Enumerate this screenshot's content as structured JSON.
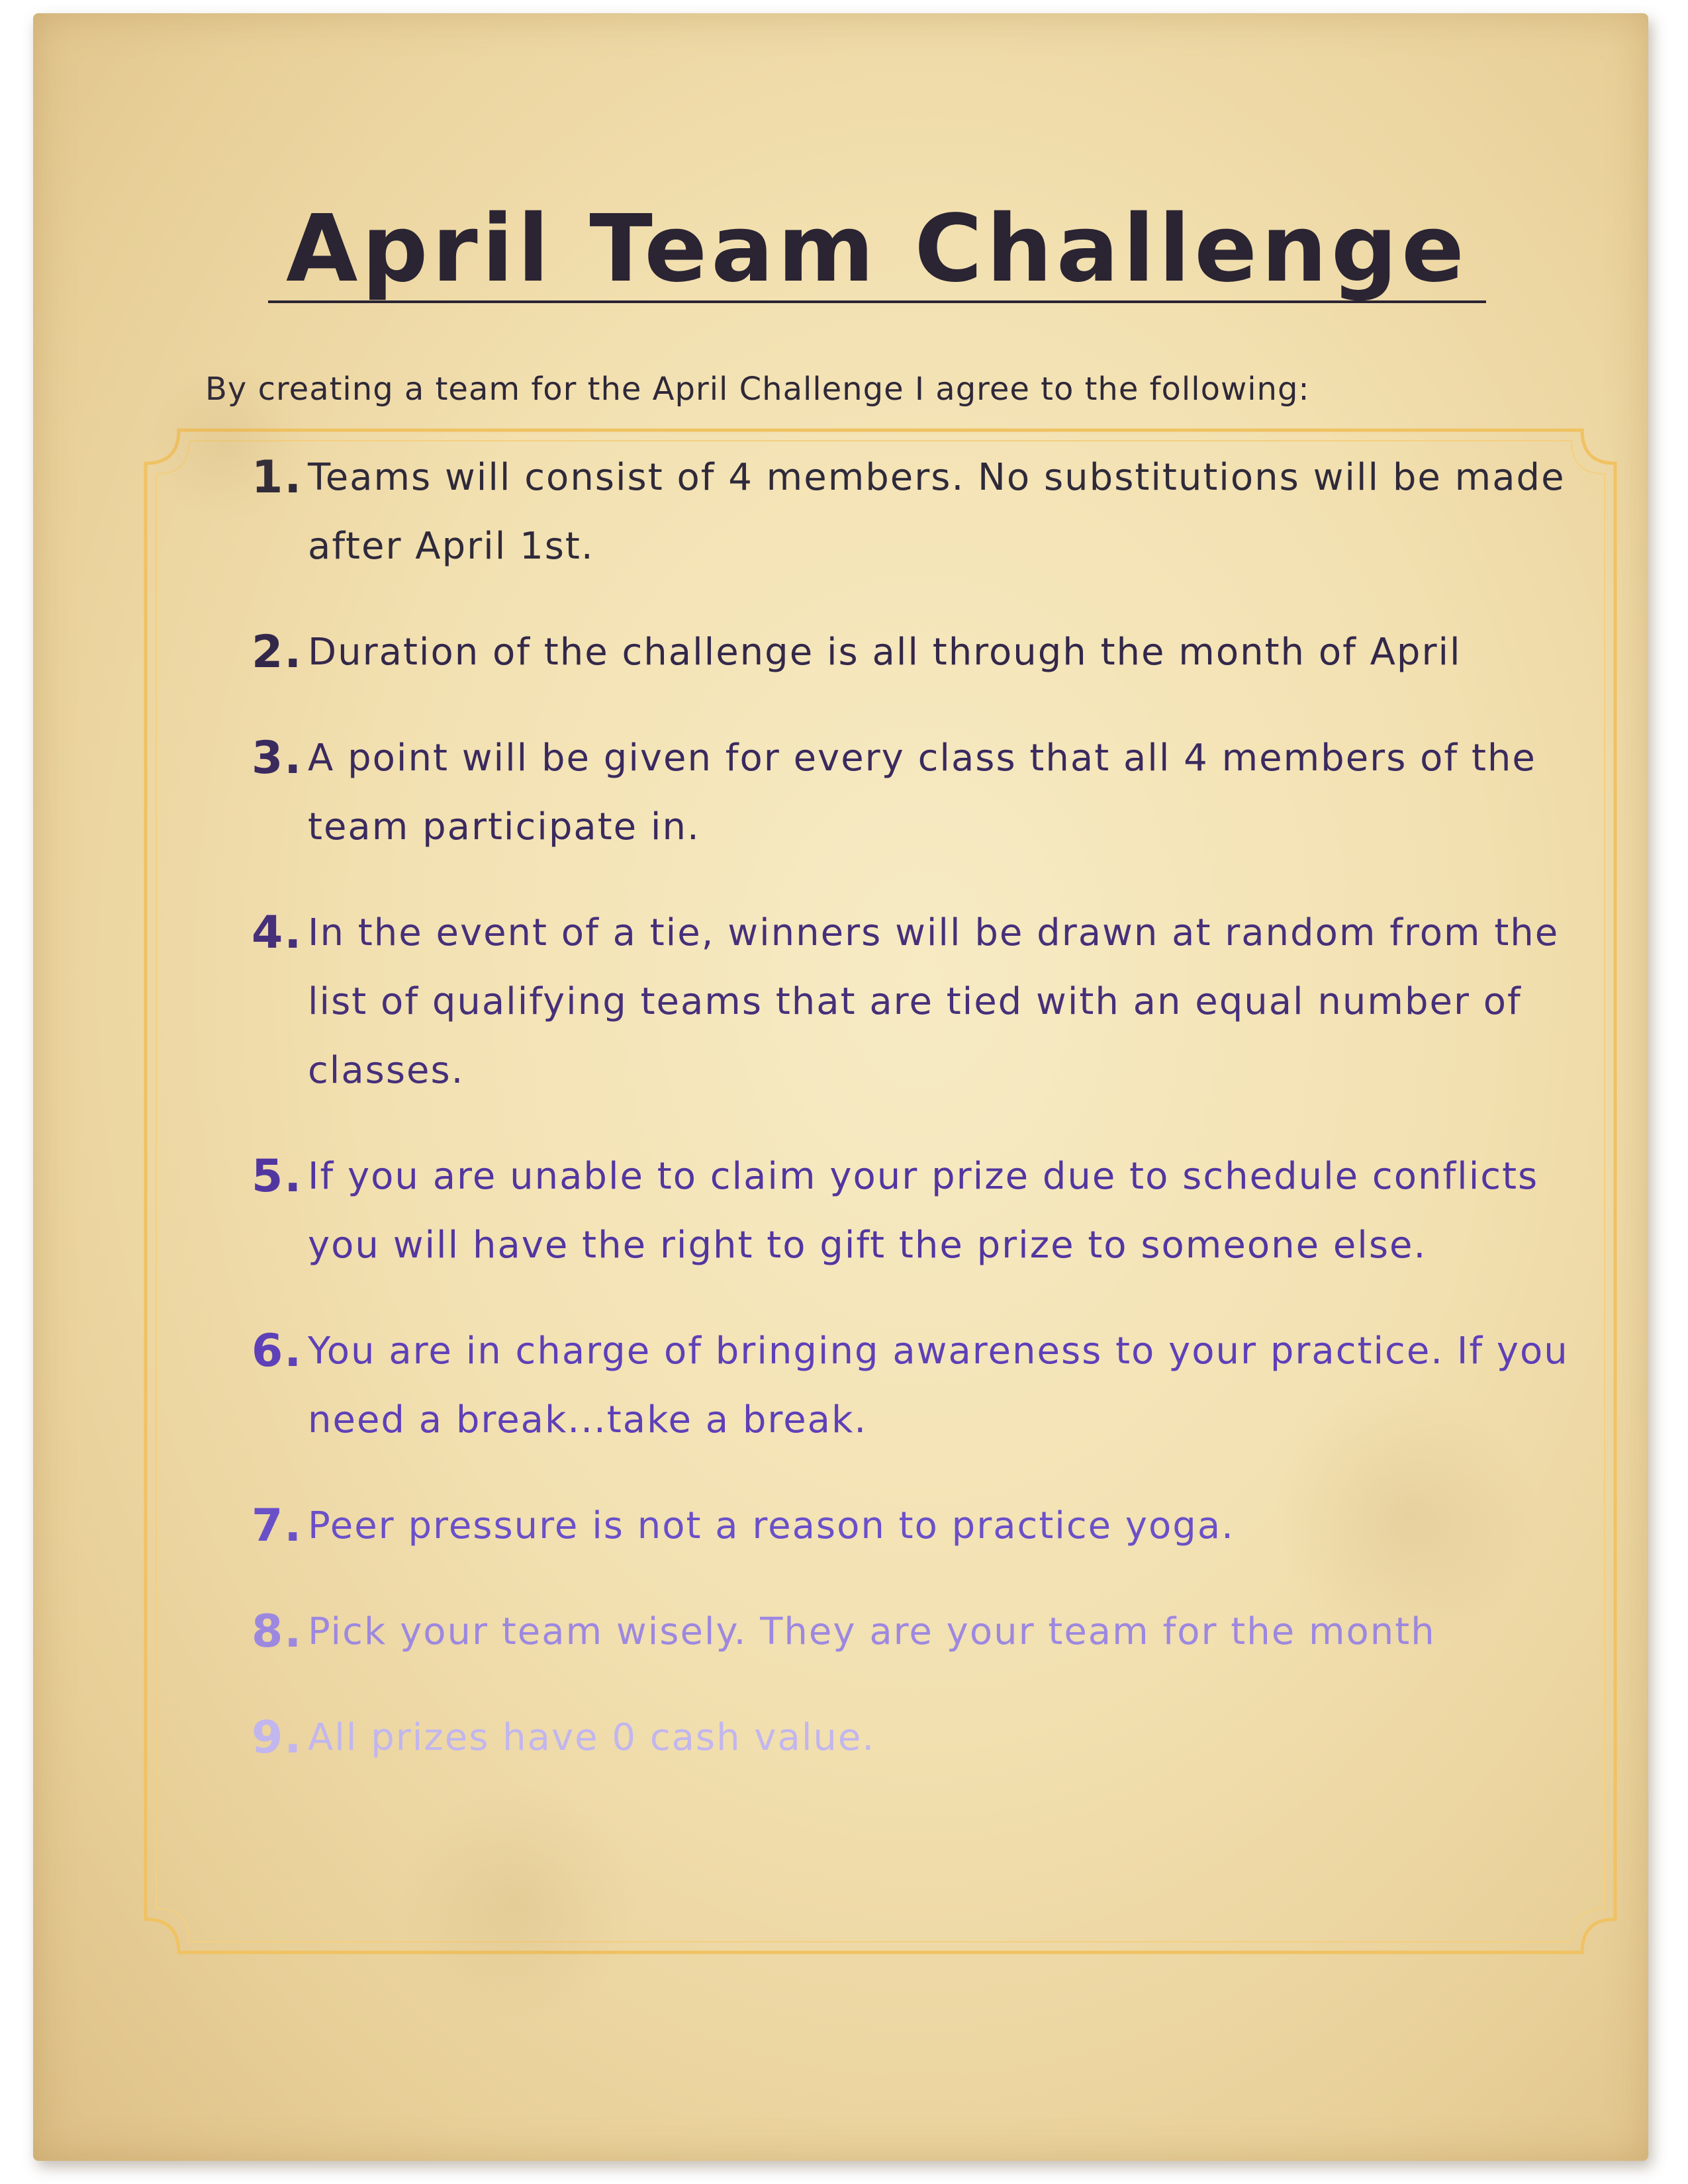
{
  "title": "April Team Challenge",
  "intro": "By creating a team for the April Challenge I agree to the following:",
  "colors": {
    "frame": "#f0c262",
    "title": "#2a2433"
  },
  "rules": [
    {
      "num": "1.",
      "text": "Teams will consist of 4 members. No substitutions will be made after April 1st.",
      "color": "#2f2a3a"
    },
    {
      "num": "2.",
      "text": "Duration of the challenge is all through the month of April",
      "color": "#33284a"
    },
    {
      "num": "3.",
      "text": "A point will be given for every class that all 4 members of the team participate in.",
      "color": "#3a2a5e"
    },
    {
      "num": "4.",
      "text": "In the event of a tie, winners will be drawn at random from the list of qualifying teams that are tied with an equal number of classes.",
      "color": "#46307a"
    },
    {
      "num": "5.",
      "text": "If you are unable to claim your prize due to schedule conflicts you will have the right to gift the prize to someone else.",
      "color": "#5236a0"
    },
    {
      "num": "6.",
      "text": "You are in charge of bringing awareness to your practice. If you need a break...take a break.",
      "color": "#5e40b8"
    },
    {
      "num": "7.",
      "text": "Peer pressure is not a reason to practice yoga.",
      "color": "#6a50c8"
    },
    {
      "num": "8.",
      "text": "Pick your team wisely. They are your team for the month",
      "color": "#9d88e0"
    },
    {
      "num": "9.",
      "text": " All prizes have 0 cash value.",
      "color": "#c2b6ee"
    }
  ]
}
